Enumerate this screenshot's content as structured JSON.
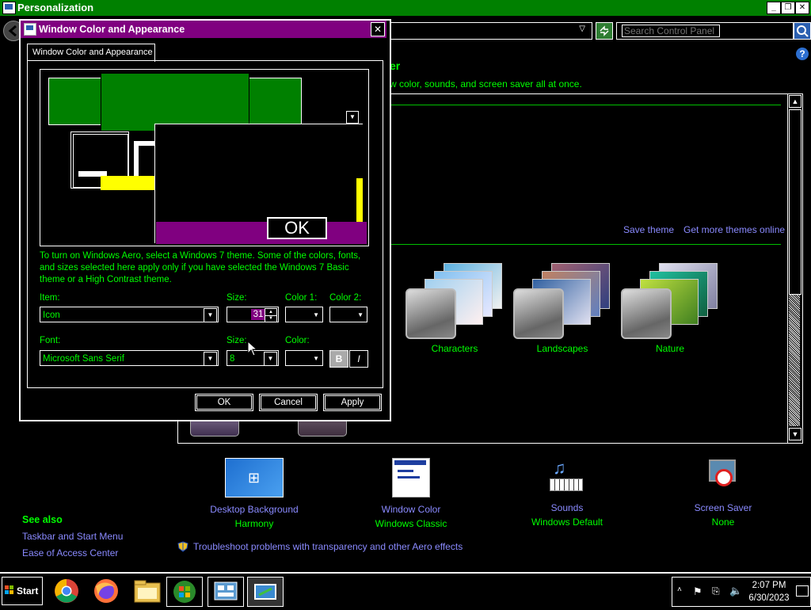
{
  "window": {
    "title": "Personalization"
  },
  "search": {
    "placeholder": "Search Control Panel"
  },
  "help_label": "?",
  "content": {
    "heading_partial": "er",
    "subtitle_partial": "w color, sounds, and screen saver all at once.",
    "save_theme": "Save theme",
    "get_more_themes": "Get more themes online",
    "themes": [
      {
        "label": "Characters"
      },
      {
        "label": "Landscapes"
      },
      {
        "label": "Nature"
      }
    ]
  },
  "bottom_items": [
    {
      "name": "Desktop Background",
      "value": "Harmony",
      "icon": "desktop-background-icon"
    },
    {
      "name": "Window Color",
      "value": "Windows Classic",
      "icon": "window-color-icon"
    },
    {
      "name": "Sounds",
      "value": "Windows Default",
      "icon": "sounds-icon"
    },
    {
      "name": "Screen Saver",
      "value": "None",
      "icon": "screen-saver-icon"
    }
  ],
  "see_also": {
    "title": "See also",
    "links": [
      "Taskbar and Start Menu",
      "Ease of Access Center"
    ]
  },
  "troubleshoot_link": "Troubleshoot problems with transparency and other Aero effects",
  "dialog": {
    "title": "Window Color and Appearance",
    "tab": "Window Color and Appearance",
    "preview_ok": "OK",
    "info": "To turn on Windows Aero, select a Windows 7 theme.  Some of the colors, fonts, and sizes selected here apply only if you have selected the Windows 7 Basic theme or a High Contrast theme.",
    "item_label": "Item:",
    "item_value": "Icon",
    "size_label": "Size:",
    "size_value": "31",
    "color1_label": "Color 1:",
    "color2_label": "Color 2:",
    "font_label": "Font:",
    "font_value": "Microsoft Sans Serif",
    "font_size_label": "Size:",
    "font_size_value": "8",
    "color_label": "Color:",
    "bold": "B",
    "italic": "I",
    "ok": "OK",
    "cancel": "Cancel",
    "apply": "Apply"
  },
  "taskbar": {
    "start": "Start",
    "time": "2:07 PM",
    "date": "6/30/2023"
  },
  "colors": {
    "title_bar": "#008000",
    "dialog_title_bar": "#800080",
    "text": "#00ff00",
    "link": "#8a8aff"
  }
}
